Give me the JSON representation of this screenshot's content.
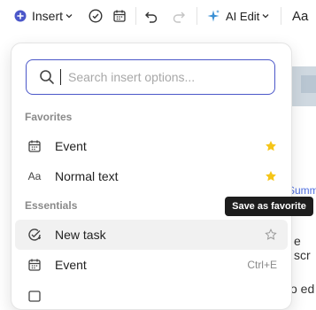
{
  "toolbar": {
    "insert_label": "Insert",
    "ai_edit_label": "AI Edit",
    "font_label": "Aa"
  },
  "background": {
    "link_fragment": "Summ",
    "text_fragment_1": "e scr",
    "text_fragment_2": "o ed"
  },
  "popup": {
    "search_placeholder": "Search insert options...",
    "favorites_label": "Favorites",
    "favorites": [
      {
        "label": "Event",
        "icon": "calendar-icon"
      },
      {
        "label": "Normal text",
        "icon": "text-aa-icon",
        "icon_text": "Aa"
      }
    ],
    "essentials_label": "Essentials",
    "essentials": [
      {
        "label": "New task",
        "icon": "task-check-icon"
      },
      {
        "label": "Event",
        "icon": "calendar-icon",
        "shortcut": "Ctrl+E"
      }
    ]
  },
  "tooltip": {
    "text": "Save as favorite"
  },
  "colors": {
    "accent": "#4b57c9",
    "star": "#f5c518",
    "tooltip_bg": "#1d1d1d"
  }
}
